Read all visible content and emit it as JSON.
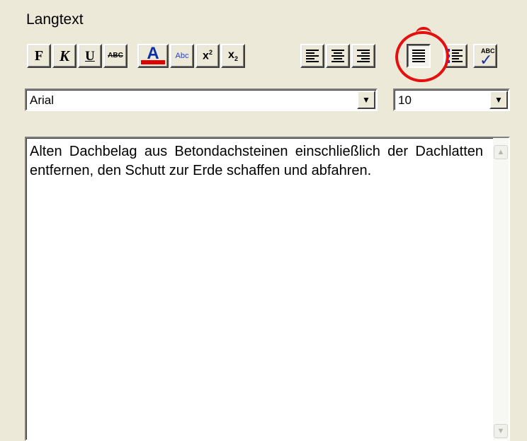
{
  "panel": {
    "title": "Langtext"
  },
  "toolbar": {
    "bold_label": "F",
    "italic_label": "K",
    "underline_label": "U",
    "strike_label": "ABC",
    "fontcolor_label": "A",
    "fontcolor_color": "#e00000",
    "highlight_label": "Abc",
    "superscript_label": "x",
    "superscript_mark": "2",
    "subscript_label": "x",
    "subscript_mark": "2",
    "spellcheck_label": "ABC",
    "active_button": "align-justify"
  },
  "font": {
    "family_value": "Arial",
    "size_value": "10"
  },
  "editor": {
    "text": "Alten Dachbelag aus Betondachsteinen einschließlich der Dachlatten entfernen, den Schutt zur Erde schaffen und abfahren."
  },
  "icons": {
    "dropdown": "chevron-down-icon",
    "scroll_up": "arrow-up-icon",
    "scroll_down": "arrow-down-icon"
  },
  "annotation": {
    "color": "#e41010",
    "target": "align-justify-button"
  }
}
